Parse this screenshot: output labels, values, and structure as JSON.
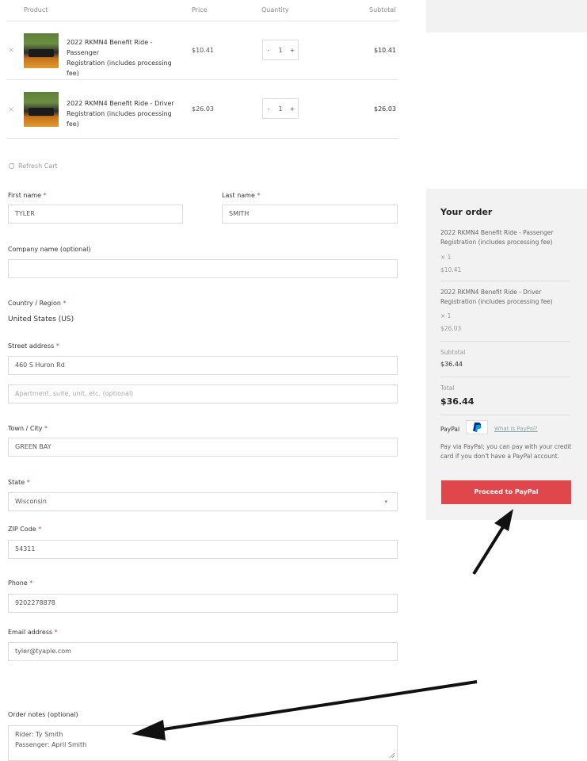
{
  "cart": {
    "headers": {
      "product": "Product",
      "price": "Price",
      "quantity": "Quantity",
      "subtotal": "Subtotal"
    },
    "items": [
      {
        "name_line1": "2022 RKMN4 Benefit Ride - Passenger",
        "name_line2": "Registration (includes processing fee)",
        "price": "$10.41",
        "qty": "1",
        "subtotal": "$10.41"
      },
      {
        "name_line1": "2022 RKMN4 Benefit Ride - Driver",
        "name_line2": "Registration (includes processing fee)",
        "price": "$26.03",
        "qty": "1",
        "subtotal": "$26.03"
      }
    ],
    "remove_glyph": "×",
    "minus": "-",
    "plus": "+",
    "refresh_label": "Refresh Cart"
  },
  "form": {
    "first_name": {
      "label": "First name",
      "value": "TYLER"
    },
    "last_name": {
      "label": "Last name",
      "value": "SMITH"
    },
    "company": {
      "label": "Company name (optional)",
      "value": ""
    },
    "country": {
      "label": "Country / Region",
      "value": "United States (US)"
    },
    "street": {
      "label": "Street address",
      "value": "460 S Huron Rd",
      "placeholder2": "Apartment, suite, unit, etc. (optional)"
    },
    "city": {
      "label": "Town / City",
      "value": "GREEN BAY"
    },
    "state": {
      "label": "State",
      "value": "Wisconsin"
    },
    "zip": {
      "label": "ZIP Code",
      "value": "54311"
    },
    "phone": {
      "label": "Phone",
      "value": "9202278878"
    },
    "email": {
      "label": "Email address",
      "value": "tyler@tyaple.com"
    },
    "notes": {
      "label": "Order notes (optional)",
      "line1": "Rider: Ty Smith",
      "line2": "Passenger:  April Smith"
    },
    "required_mark": "*"
  },
  "order": {
    "title": "Your order",
    "items": [
      {
        "line1": "2022 RKMN4 Benefit Ride - Passenger",
        "line2": "Registration (includes processing fee)",
        "qty": "× 1",
        "price": "$10.41"
      },
      {
        "line1": "2022 RKMN4 Benefit Ride - Driver",
        "line2": "Registration (includes processing fee)",
        "qty": "× 1",
        "price": "$26.03"
      }
    ],
    "subtotal_label": "Subtotal",
    "subtotal_value": "$36.44",
    "total_label": "Total",
    "total_value": "$36.44",
    "paypal_label": "PayPal",
    "paypal_link": "What is PayPal?",
    "paypal_desc1": "Pay via PayPal; you can pay with your credit",
    "paypal_desc2": "card if you don't have a PayPal account.",
    "button": "Proceed to PayPal",
    "button_color": "#e0474c"
  }
}
